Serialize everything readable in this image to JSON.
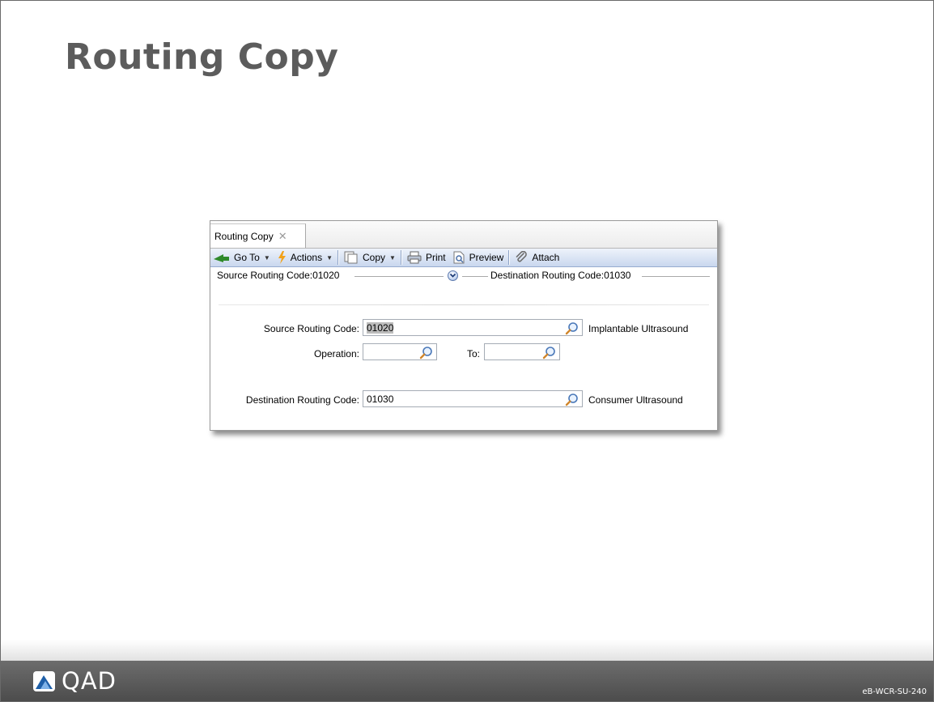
{
  "slide": {
    "title": "Routing Copy",
    "footer_logo_text": "QAD",
    "footer_code": "eB-WCR-SU-240"
  },
  "window": {
    "tab_label": "Routing Copy",
    "tab_close_icon": "close-icon",
    "toolbar": {
      "goto_label": "Go To",
      "actions_label": "Actions",
      "copy_label": "Copy",
      "print_label": "Print",
      "preview_label": "Preview",
      "attach_label": "Attach"
    },
    "summary": {
      "left_text": "Source Routing Code:01020",
      "right_text": "Destination Routing Code:01030",
      "expand_icon": "expand-circle-icon"
    },
    "form": {
      "source_label": "Source Routing Code:",
      "source_value": "01020",
      "source_desc": "Implantable Ultrasound",
      "operation_label": "Operation:",
      "operation_value": "",
      "to_label": "To:",
      "to_value": "",
      "dest_label": "Destination Routing Code:",
      "dest_value": "01030",
      "dest_desc": "Consumer Ultrasound",
      "lookup_icon": "magnifier-icon"
    }
  },
  "colors": {
    "title": "#5c5c5c",
    "footer_dark": "#4c4c4c",
    "toolbar_top": "#eef3fb",
    "toolbar_bottom": "#c9d7ee"
  }
}
